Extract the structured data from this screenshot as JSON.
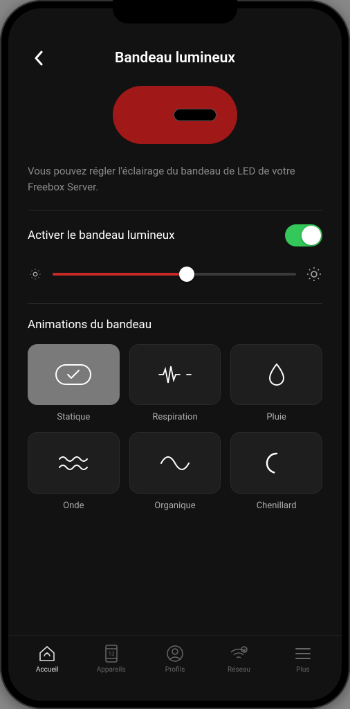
{
  "header": {
    "title": "Bandeau lumineux"
  },
  "description": "Vous pouvez régler l'éclairage du bandeau de LED de votre Freebox Server.",
  "toggle": {
    "label": "Activer le bandeau lumineux",
    "on": true
  },
  "brightness": {
    "value": 55
  },
  "animations": {
    "title": "Animations du bandeau",
    "items": [
      {
        "label": "Statique",
        "selected": true
      },
      {
        "label": "Respiration",
        "selected": false
      },
      {
        "label": "Pluie",
        "selected": false
      },
      {
        "label": "Onde",
        "selected": false
      },
      {
        "label": "Organique",
        "selected": false
      },
      {
        "label": "Chenillard",
        "selected": false
      }
    ]
  },
  "tabbar": {
    "items": [
      {
        "label": "Accueil",
        "active": true
      },
      {
        "label": "Appareils",
        "active": false,
        "badge": "13"
      },
      {
        "label": "Profils",
        "active": false
      },
      {
        "label": "Réseau",
        "active": false
      },
      {
        "label": "Plus",
        "active": false
      }
    ]
  }
}
